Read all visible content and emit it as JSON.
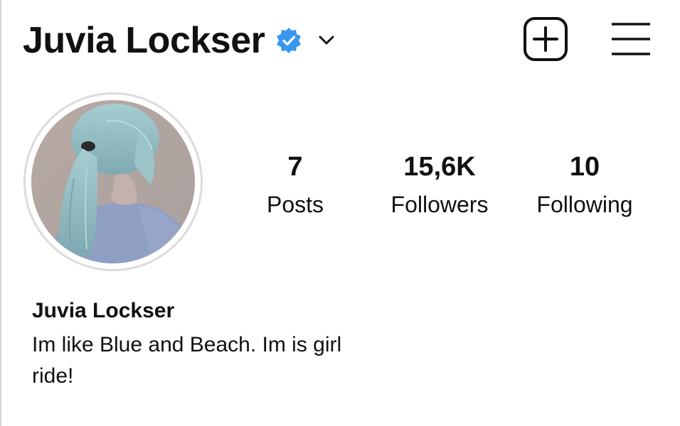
{
  "header": {
    "username": "Juvia Lockser",
    "verified_icon": "verified-badge-icon",
    "verified_color": "#3897f0",
    "dropdown_icon": "chevron-down-icon",
    "new_post_icon": "plus-square-icon",
    "menu_icon": "hamburger-menu-icon"
  },
  "profile": {
    "avatar_description_icon": "avatar-photo",
    "stats": [
      {
        "value": "7",
        "label": "Posts"
      },
      {
        "value": "15,6K",
        "label": "Followers"
      },
      {
        "value": "10",
        "label": "Following"
      }
    ],
    "display_name": "Juvia Lockser",
    "bio": "Im like Blue and Beach. Im is girl ride!"
  },
  "colors": {
    "text": "#111111",
    "avatar_ring": "#dcdcdc",
    "hair": "#8fb8bf",
    "sweater": "#8f9fc4"
  }
}
